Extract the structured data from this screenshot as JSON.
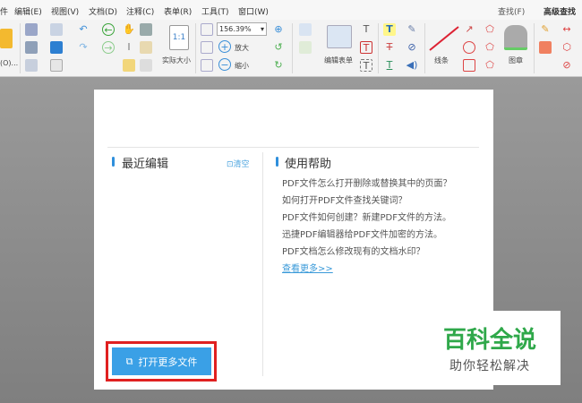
{
  "menu": [
    "件",
    "编辑(E)",
    "视图(V)",
    "文档(D)",
    "注释(C)",
    "表单(R)",
    "工具(T)",
    "窗口(W)"
  ],
  "search": {
    "find": "查找(F)",
    "advanced": "高级查找"
  },
  "toolbar": {
    "open_partial": "(O)...",
    "zoom_value": "156.39%",
    "actual_size": "实际大小",
    "zoom_in": "放大",
    "zoom_out": "缩小",
    "edit_form": "编辑表单",
    "lines": "线条",
    "stamp": "图章"
  },
  "recent": {
    "title": "最近编辑",
    "clear": "清空"
  },
  "help": {
    "title": "使用帮助",
    "items": [
      "PDF文件怎么打开删除或替换其中的页面？",
      "如何打开PDF文件查找关键词？",
      "PDF文件如何创建？新建PDF文件的方法。",
      "迅捷PDF编辑器给PDF文件加密的方法。",
      "PDF文档怎么修改现有的文档水印？"
    ],
    "more": "查看更多>>"
  },
  "open_more": "打开更多文件",
  "watermark": {
    "line1": "百科全说",
    "line2": "助你轻松解决"
  },
  "colors": {
    "accent": "#3aa0e6",
    "highlight": "#e02020",
    "watermark": "#2fa84a"
  }
}
